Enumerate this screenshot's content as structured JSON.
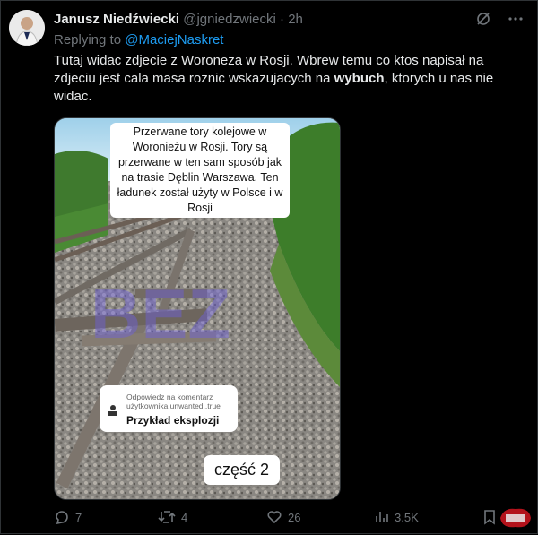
{
  "author": {
    "name": "Janusz Niedźwiecki",
    "handle": "@jgniedzwiecki",
    "time": "2h"
  },
  "reply": {
    "prefix": "Replying to ",
    "to": "@MaciejNaskret"
  },
  "tweet": {
    "text_before": "Tutaj widac zdjecie z Woroneza w Rosji. Wbrew temu co ktos napisał na zdjeciu jest cala masa roznic wskazujacych na ",
    "bold": "wybuch",
    "text_after": ", ktorych u nas nie widac."
  },
  "media": {
    "caption": "Przerwane tory kolejowe w Woronieżu w Rosji. Tory są przerwane w ten sam sposób jak na trasie Dęblin Warszawa. Ten ładunek został użyty w Polsce i w Rosji",
    "comment_small": "Odpowiedz na komentarz użytkownika unwanted..true",
    "comment_big": "Przykład eksplozji",
    "part_label": "część 2",
    "watermark": "BEZ"
  },
  "actions": {
    "replies": "7",
    "retweets": "4",
    "likes": "26",
    "views": "3.5K"
  },
  "colors": {
    "link": "#1d9bf0",
    "muted": "#71767b",
    "text": "#e7e9ea",
    "background": "#000000"
  }
}
